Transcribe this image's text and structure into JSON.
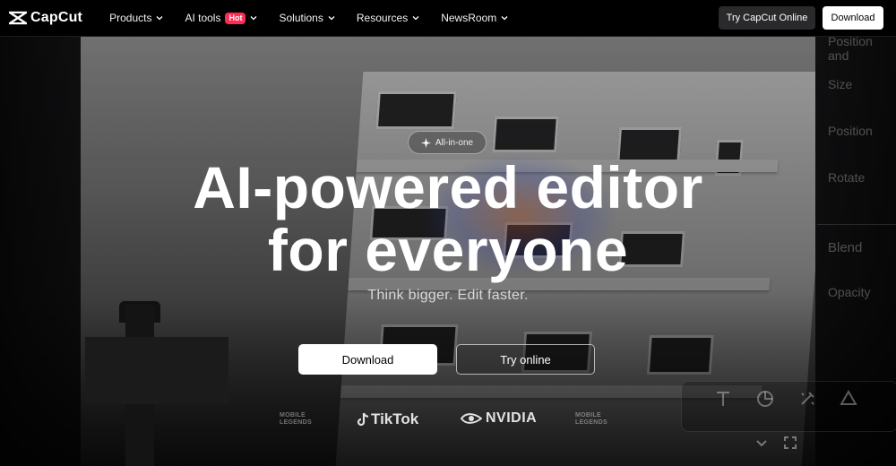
{
  "header": {
    "logo_text": "CapCut",
    "nav": [
      {
        "label": "Products"
      },
      {
        "label": "AI tools",
        "badge": "Hot"
      },
      {
        "label": "Solutions"
      },
      {
        "label": "Resources"
      },
      {
        "label": "NewsRoom"
      }
    ],
    "try_online_label": "Try CapCut Online",
    "download_label": "Download"
  },
  "hero": {
    "pill_label": "All-in-one",
    "headline_line1": "AI-powered editor",
    "headline_line2": "for everyone",
    "subheadline": "Think bigger. Edit faster.",
    "download_label": "Download",
    "try_online_label": "Try online"
  },
  "brands": {
    "mobile_legends": "MOBILE LEGENDS",
    "tiktok": "TikTok",
    "nvidia": "NVIDIA"
  },
  "background_panel": {
    "items": [
      "Position and",
      "Size",
      "Position",
      "Rotate",
      "Blend",
      "Opacity"
    ]
  },
  "colors": {
    "header_bg": "#000000",
    "badge": "#fe2c55",
    "primary_button": "#ffffff"
  }
}
